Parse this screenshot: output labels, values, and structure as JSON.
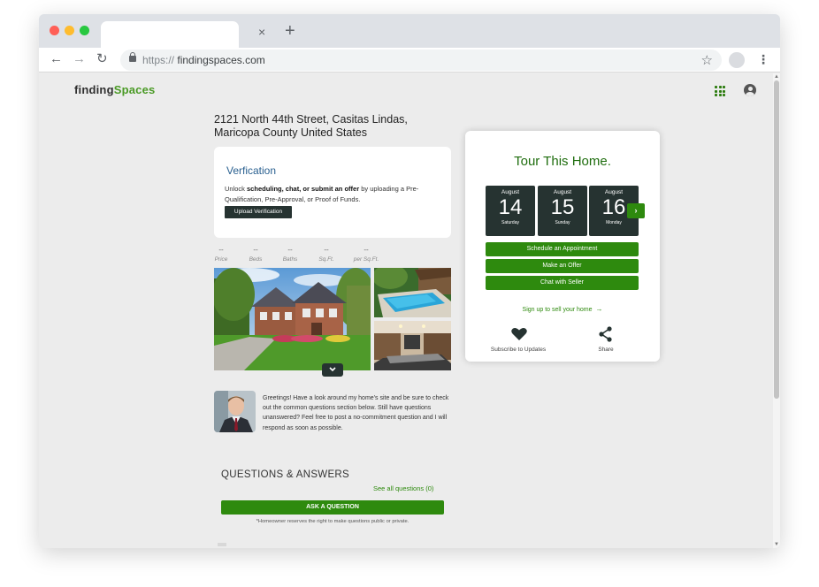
{
  "browser": {
    "url_protocol": "https://",
    "url_host": "findingspaces.com",
    "tab_close": "×",
    "new_tab": "+",
    "back_icon": "←",
    "forward_icon": "→",
    "reload_icon": "↻",
    "star_icon": "☆",
    "menu_icon": "⋮"
  },
  "site": {
    "logo_part1": "finding",
    "logo_part2": "Spaces",
    "accent_color": "#2e8a0e",
    "dark_color": "#263331"
  },
  "listing": {
    "address": "2121 North 44th Street, Casitas Lindas, Maricopa County United States"
  },
  "verification": {
    "title": "Verfication",
    "text_before": "Unlock ",
    "text_bold": "scheduling, chat, or submit an offer",
    "text_after": " by uploading a Pre-Qualification, Pre-Approval, or Proof of Funds.",
    "button": "Upload Verification"
  },
  "stats": [
    {
      "value": "--",
      "label": "Price"
    },
    {
      "value": "--",
      "label": "Beds"
    },
    {
      "value": "--",
      "label": "Baths"
    },
    {
      "value": "--",
      "label": "Sq.Ft."
    },
    {
      "value": "--",
      "label": "per Sq.Ft."
    }
  ],
  "gallery": {
    "expand_icon": "chevron-down-icon"
  },
  "seller": {
    "message": "Greetings! Have a look around my home's site and be sure to check out the common questions section below. Still have questions unanswered? Feel free to post a no-commitment question and I will respond as soon as possible."
  },
  "qa": {
    "title": "QUESTIONS & ANSWERS",
    "see_all": "See all questions (0)",
    "ask_button": "ASK A QUESTION",
    "note": "*Homeowner reserves the right to make questions public or private."
  },
  "tour": {
    "title": "Tour This Home.",
    "dates": [
      {
        "month": "August",
        "day": "14",
        "weekday": "Saturday"
      },
      {
        "month": "August",
        "day": "15",
        "weekday": "Sunday"
      },
      {
        "month": "August",
        "day": "16",
        "weekday": "Monday"
      }
    ],
    "next_icon": "›",
    "buttons": [
      "Schedule an Appointment",
      "Make an Offer",
      "Chat with Seller"
    ],
    "signup": "Sign up to sell your home",
    "subscribe": "Subscribe to Updates",
    "share": "Share"
  }
}
